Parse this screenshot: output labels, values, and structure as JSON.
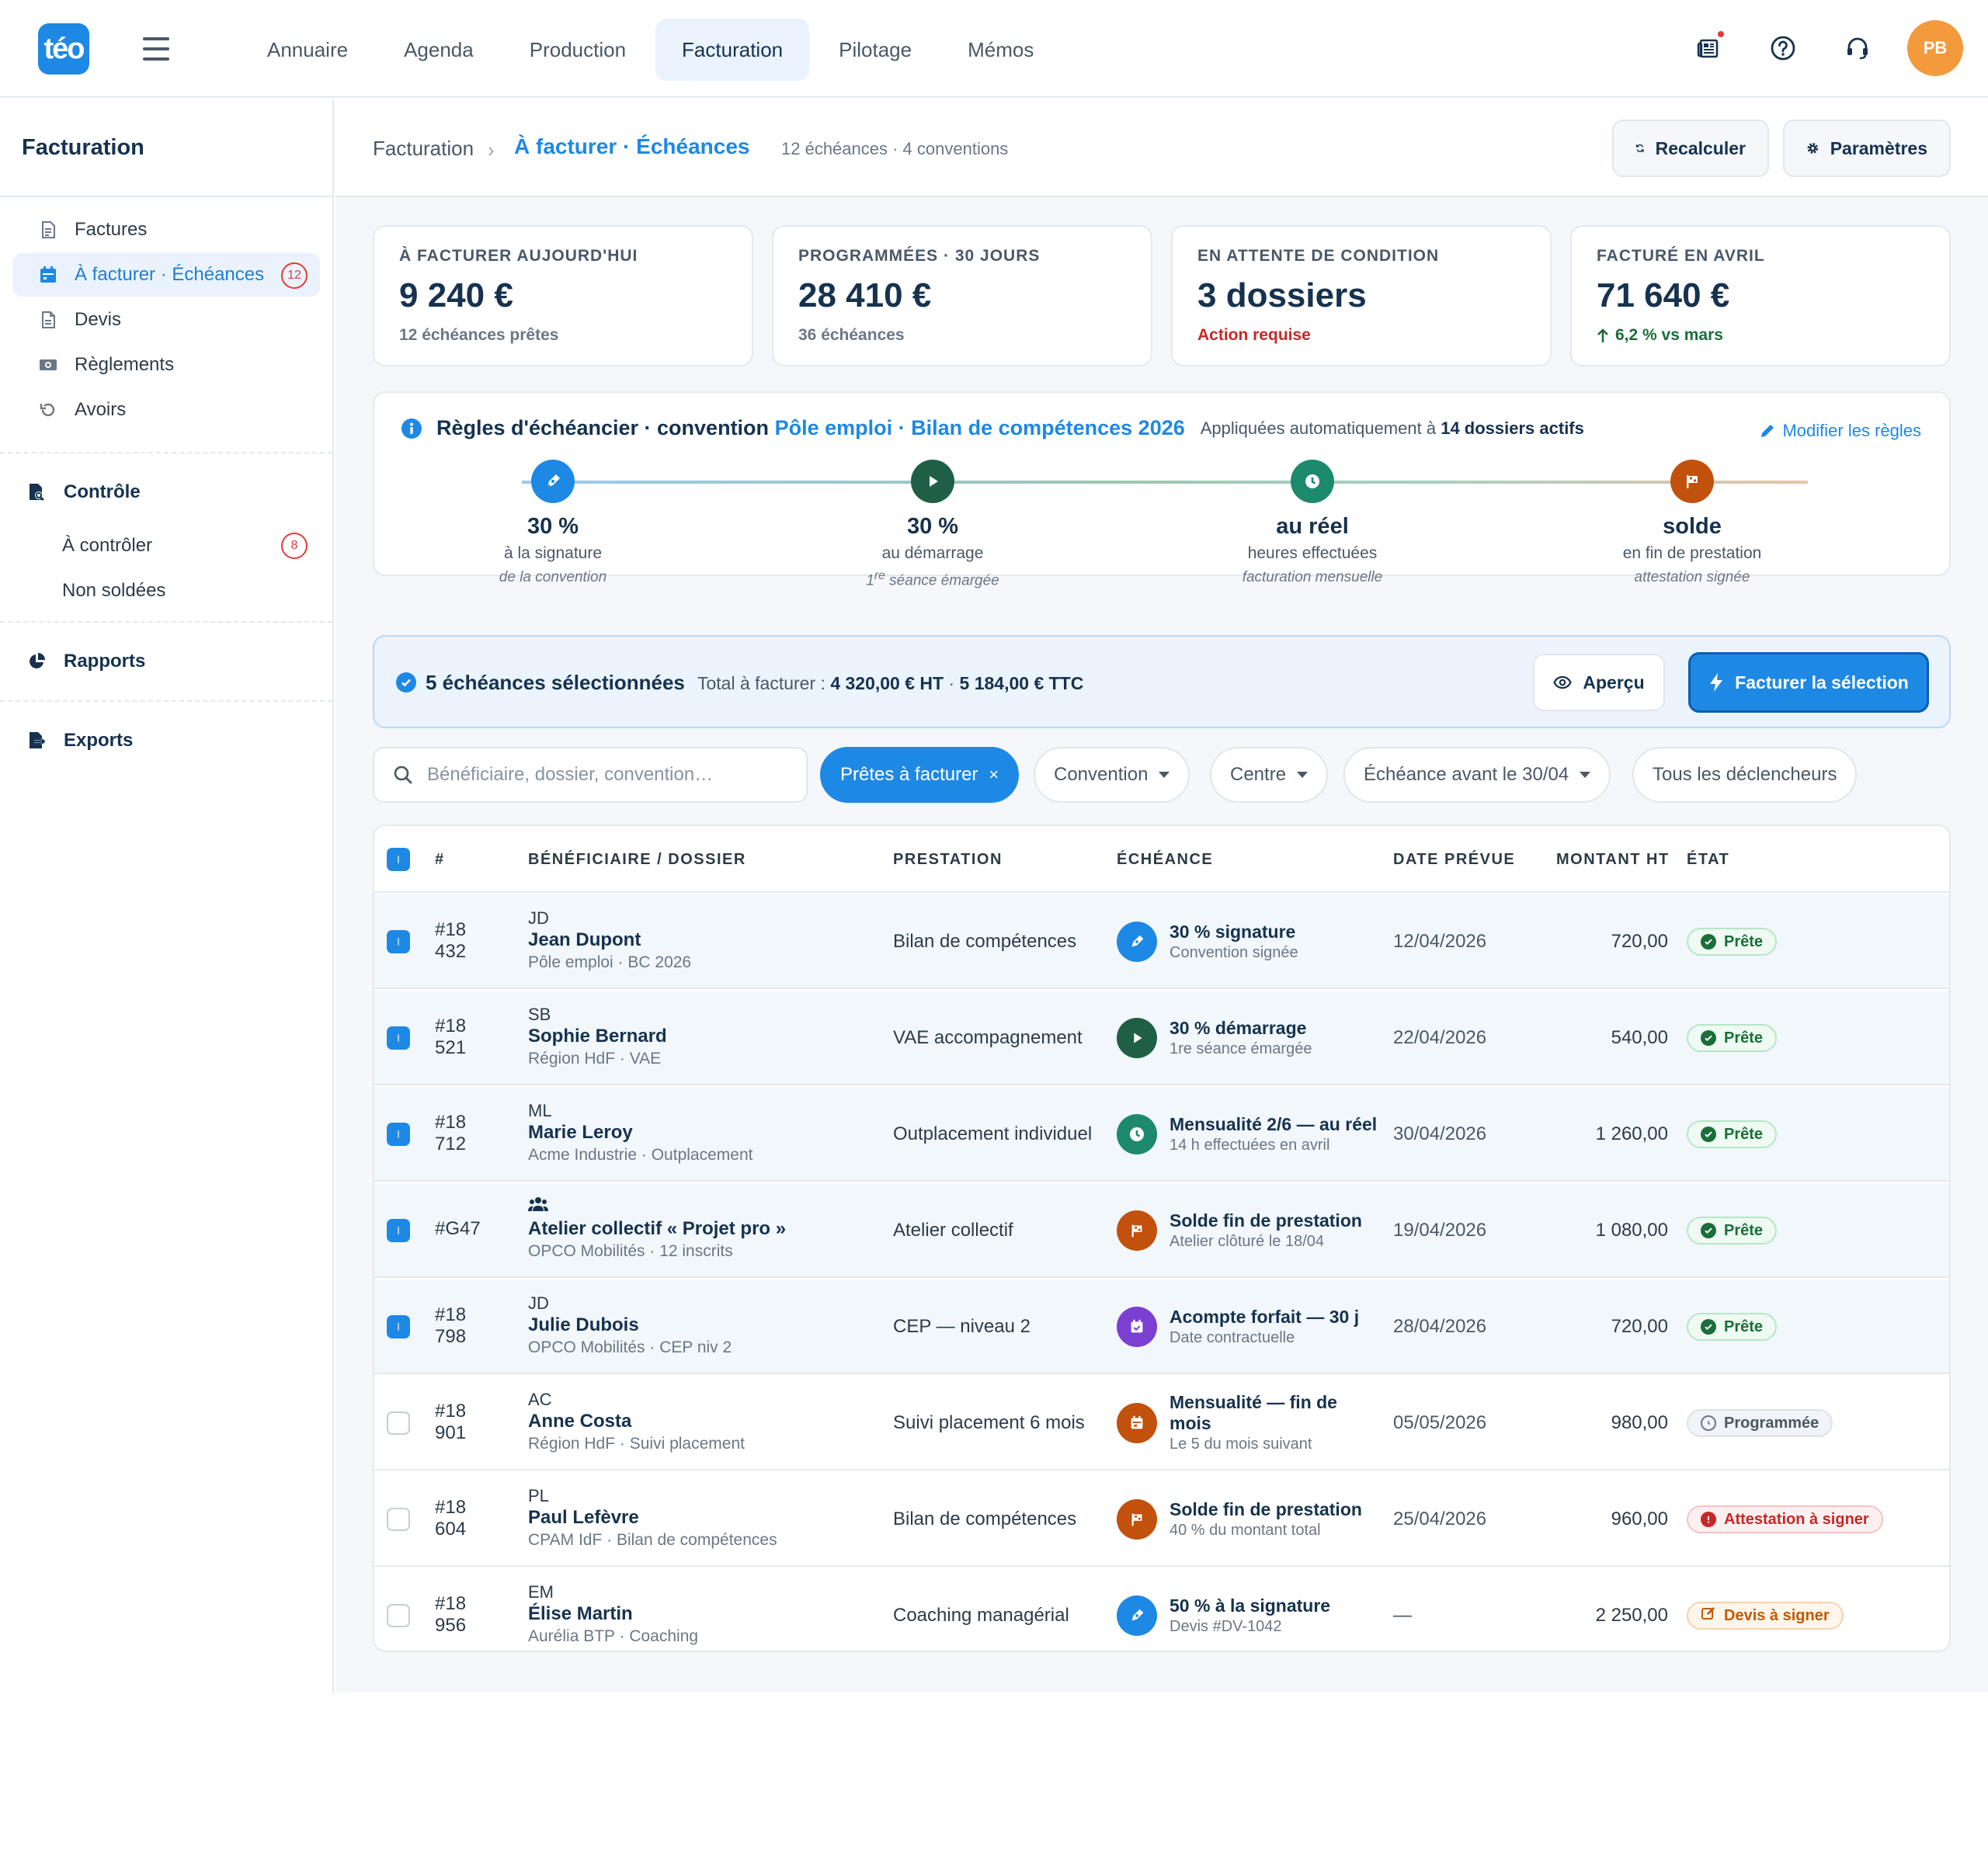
{
  "topbar": {
    "logo_text": "téo",
    "nav": [
      "Annuaire",
      "Agenda",
      "Production",
      "Facturation",
      "Pilotage",
      "Mémos"
    ],
    "active_nav": "Facturation",
    "avatar_initials": "PB",
    "icons": [
      "news-icon",
      "help-icon",
      "support-headset-icon"
    ]
  },
  "sidebar": {
    "title": "Facturation",
    "items": [
      {
        "label": "Factures",
        "icon": "invoice-icon"
      },
      {
        "label": "À facturer · Échéances",
        "icon": "calendar-icon",
        "badge": "12",
        "active": true
      },
      {
        "label": "Devis",
        "icon": "document-icon"
      },
      {
        "label": "Règlements",
        "icon": "money-icon"
      },
      {
        "label": "Avoirs",
        "icon": "undo-icon"
      }
    ],
    "controle": {
      "label": "Contrôle",
      "subs": [
        {
          "label": "À contrôler",
          "badge": "8"
        },
        {
          "label": "Non soldées"
        }
      ]
    },
    "rapports": "Rapports",
    "exports": "Exports"
  },
  "header": {
    "crumb_root": "Facturation",
    "crumb_current": "À facturer · Échéances",
    "meta": "12 échéances · 4 conventions",
    "btn_recalc": "Recalculer",
    "btn_params": "Paramètres"
  },
  "kpis": [
    {
      "label": "À FACTURER AUJOURD'HUI",
      "value": "9 240 €",
      "sub": "12 échéances prêtes",
      "tone": "muted"
    },
    {
      "label": "PROGRAMMÉES · 30 JOURS",
      "value": "28 410 €",
      "sub": "36 échéances",
      "tone": "muted"
    },
    {
      "label": "EN ATTENTE DE CONDITION",
      "value": "3 dossiers",
      "sub": "Action requise",
      "tone": "red"
    },
    {
      "label": "FACTURÉ EN AVRIL",
      "value": "71 640 €",
      "sub": "6,2 % vs mars",
      "tone": "green"
    }
  ],
  "rules": {
    "title": "Règles d'échéancier · convention",
    "convention": "Pôle emploi · Bilan de compétences 2026",
    "applied_prefix": "Appliquées automatiquement à",
    "applied_count": "14 dossiers actifs",
    "edit": "Modifier les règles",
    "steps": [
      {
        "amount": "30 %",
        "label": "à la signature",
        "note": "de la convention",
        "color": "#1e88e5",
        "icon": "pen-icon"
      },
      {
        "amount": "30 %",
        "label": "au démarrage",
        "note_sup": "re",
        "note_pre": "1",
        "note": " séance émargée",
        "color": "#1f5f45",
        "icon": "play-icon"
      },
      {
        "amount": "au réel",
        "label": "heures effectuées",
        "note": "facturation mensuelle",
        "color": "#1d8a6b",
        "icon": "clock-icon"
      },
      {
        "amount": "solde",
        "label": "en fin de prestation",
        "note": "attestation signée",
        "color": "#c1510c",
        "icon": "flag-icon"
      }
    ]
  },
  "selection": {
    "count_label": "5 échéances sélectionnées",
    "total_prefix": "Total à facturer :",
    "total_ht": "4 320,00 € HT",
    "sep": "·",
    "total_ttc": "5 184,00 € TTC",
    "btn_preview": "Aperçu",
    "btn_invoice": "Facturer la sélection"
  },
  "filters": {
    "search_placeholder": "Bénéficiaire, dossier, convention…",
    "chips": [
      {
        "label": "Prêtes à facturer",
        "active": true
      },
      {
        "label": "Convention"
      },
      {
        "label": "Centre"
      },
      {
        "label": "Échéance avant le 30/04"
      },
      {
        "label": "Tous les déclencheurs"
      }
    ]
  },
  "table": {
    "columns": [
      "#",
      "BÉNÉFICIAIRE / DOSSIER",
      "PRESTATION",
      "ÉCHÉANCE",
      "DATE PRÉVUE",
      "MONTANT HT",
      "ÉTAT"
    ],
    "rows": [
      {
        "checked": true,
        "num1": "#18",
        "num2": "432",
        "initials": "JD",
        "name": "Jean Dupont",
        "desc": "Pôle emploi · BC 2026",
        "prestation": "Bilan de compétences",
        "ech_title": "30 % signature",
        "ech_sub": "Convention signée",
        "ech_color": "#1e88e5",
        "ech_icon": "pen-icon",
        "date": "12/04/2026",
        "amount": "720,00",
        "status": "Prête",
        "status_tone": "green"
      },
      {
        "checked": true,
        "num1": "#18",
        "num2": "521",
        "initials": "SB",
        "name": "Sophie Bernard",
        "desc": "Région HdF · VAE",
        "prestation": "VAE accompagnement",
        "ech_title": "30 % démarrage",
        "ech_sub": "1re séance émargée",
        "ech_color": "#1f5f45",
        "ech_icon": "play-icon",
        "date": "22/04/2026",
        "amount": "540,00",
        "status": "Prête",
        "status_tone": "green"
      },
      {
        "checked": true,
        "num1": "#18",
        "num2": "712",
        "initials": "ML",
        "name": "Marie Leroy",
        "desc": "Acme Industrie · Outplacement",
        "prestation": "Outplacement individuel",
        "ech_title": "Mensualité 2/6 — au réel",
        "ech_sub": "14 h effectuées en avril",
        "ech_color": "#1d8a6b",
        "ech_icon": "clock-icon",
        "date": "30/04/2026",
        "amount": "1 260,00",
        "status": "Prête",
        "status_tone": "green"
      },
      {
        "checked": true,
        "num1": "#G47",
        "num2": "",
        "initials": "",
        "group": true,
        "name": "Atelier collectif « Projet pro »",
        "desc": "OPCO Mobilités · 12 inscrits",
        "prestation": "Atelier collectif",
        "ech_title": "Solde fin de prestation",
        "ech_sub": "Atelier clôturé le 18/04",
        "ech_color": "#c1510c",
        "ech_icon": "flag-icon",
        "date": "19/04/2026",
        "amount": "1 080,00",
        "status": "Prête",
        "status_tone": "green"
      },
      {
        "checked": true,
        "num1": "#18",
        "num2": "798",
        "initials": "JD",
        "name": "Julie Dubois",
        "desc": "OPCO Mobilités · CEP niv 2",
        "prestation": "CEP — niveau 2",
        "ech_title": "Acompte forfait — 30 j",
        "ech_sub": "Date contractuelle",
        "ech_color": "#7b3fd1",
        "ech_icon": "calendar-check-icon",
        "date": "28/04/2026",
        "amount": "720,00",
        "status": "Prête",
        "status_tone": "green"
      },
      {
        "checked": false,
        "num1": "#18",
        "num2": "901",
        "initials": "AC",
        "name": "Anne Costa",
        "desc": "Région HdF · Suivi placement",
        "prestation": "Suivi placement 6 mois",
        "ech_title": "Mensualité — fin de mois",
        "ech_sub": "Le 5 du mois suivant",
        "ech_color": "#c1510c",
        "ech_icon": "calendar-icon",
        "date": "05/05/2026",
        "amount": "980,00",
        "status": "Programmée",
        "status_tone": "grey"
      },
      {
        "checked": false,
        "num1": "#18",
        "num2": "604",
        "initials": "PL",
        "name": "Paul Lefèvre",
        "desc": "CPAM IdF · Bilan de compétences",
        "prestation": "Bilan de compétences",
        "ech_title": "Solde fin de prestation",
        "ech_sub": "40 % du montant total",
        "ech_color": "#c1510c",
        "ech_icon": "flag-icon",
        "date": "25/04/2026",
        "amount": "960,00",
        "status": "Attestation à signer",
        "status_tone": "red"
      },
      {
        "checked": false,
        "num1": "#18",
        "num2": "956",
        "initials": "EM",
        "name": "Élise Martin",
        "desc": "Aurélia BTP · Coaching",
        "prestation": "Coaching managérial",
        "ech_title": "50 % à la signature",
        "ech_sub": "Devis #DV-1042",
        "ech_color": "#1e88e5",
        "ech_icon": "pen-icon",
        "date": "—",
        "amount": "2 250,00",
        "status": "Devis à signer",
        "status_tone": "orange"
      }
    ]
  },
  "colors": {
    "accent": "#1e88e5",
    "navy": "#16324f",
    "green": "#1b6e3a",
    "red": "#c62828",
    "orange": "#c25a00"
  }
}
